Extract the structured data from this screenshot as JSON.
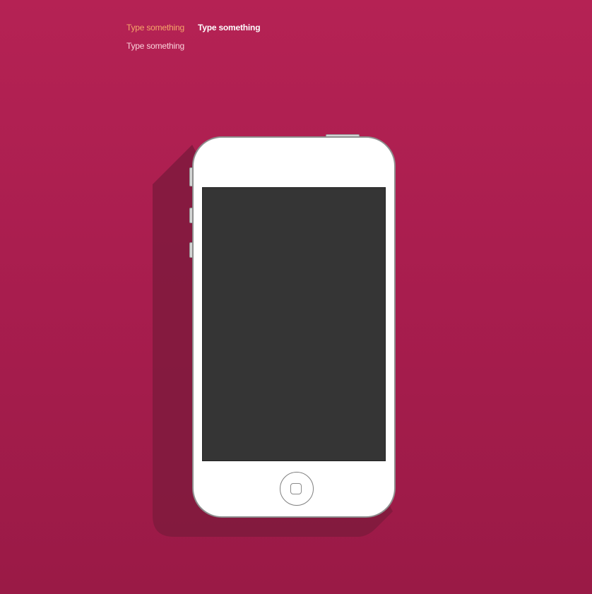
{
  "labels": {
    "top_left": "Type something",
    "top_right": "Type something",
    "bottom_left": "Type something"
  },
  "colors": {
    "background": "#b12154",
    "label_orange": "#f7a86a",
    "label_white": "#ffffff",
    "label_pink": "#fbd3dc",
    "phone_body": "#ffffff",
    "phone_screen": "#353535",
    "long_shadow": "#7f1a3d"
  },
  "device": {
    "icons": {
      "home_button": "home-button-icon",
      "volume_up": "volume-up-button",
      "volume_down": "volume-down-button",
      "mute_switch": "mute-switch",
      "power_button": "power-button"
    }
  }
}
